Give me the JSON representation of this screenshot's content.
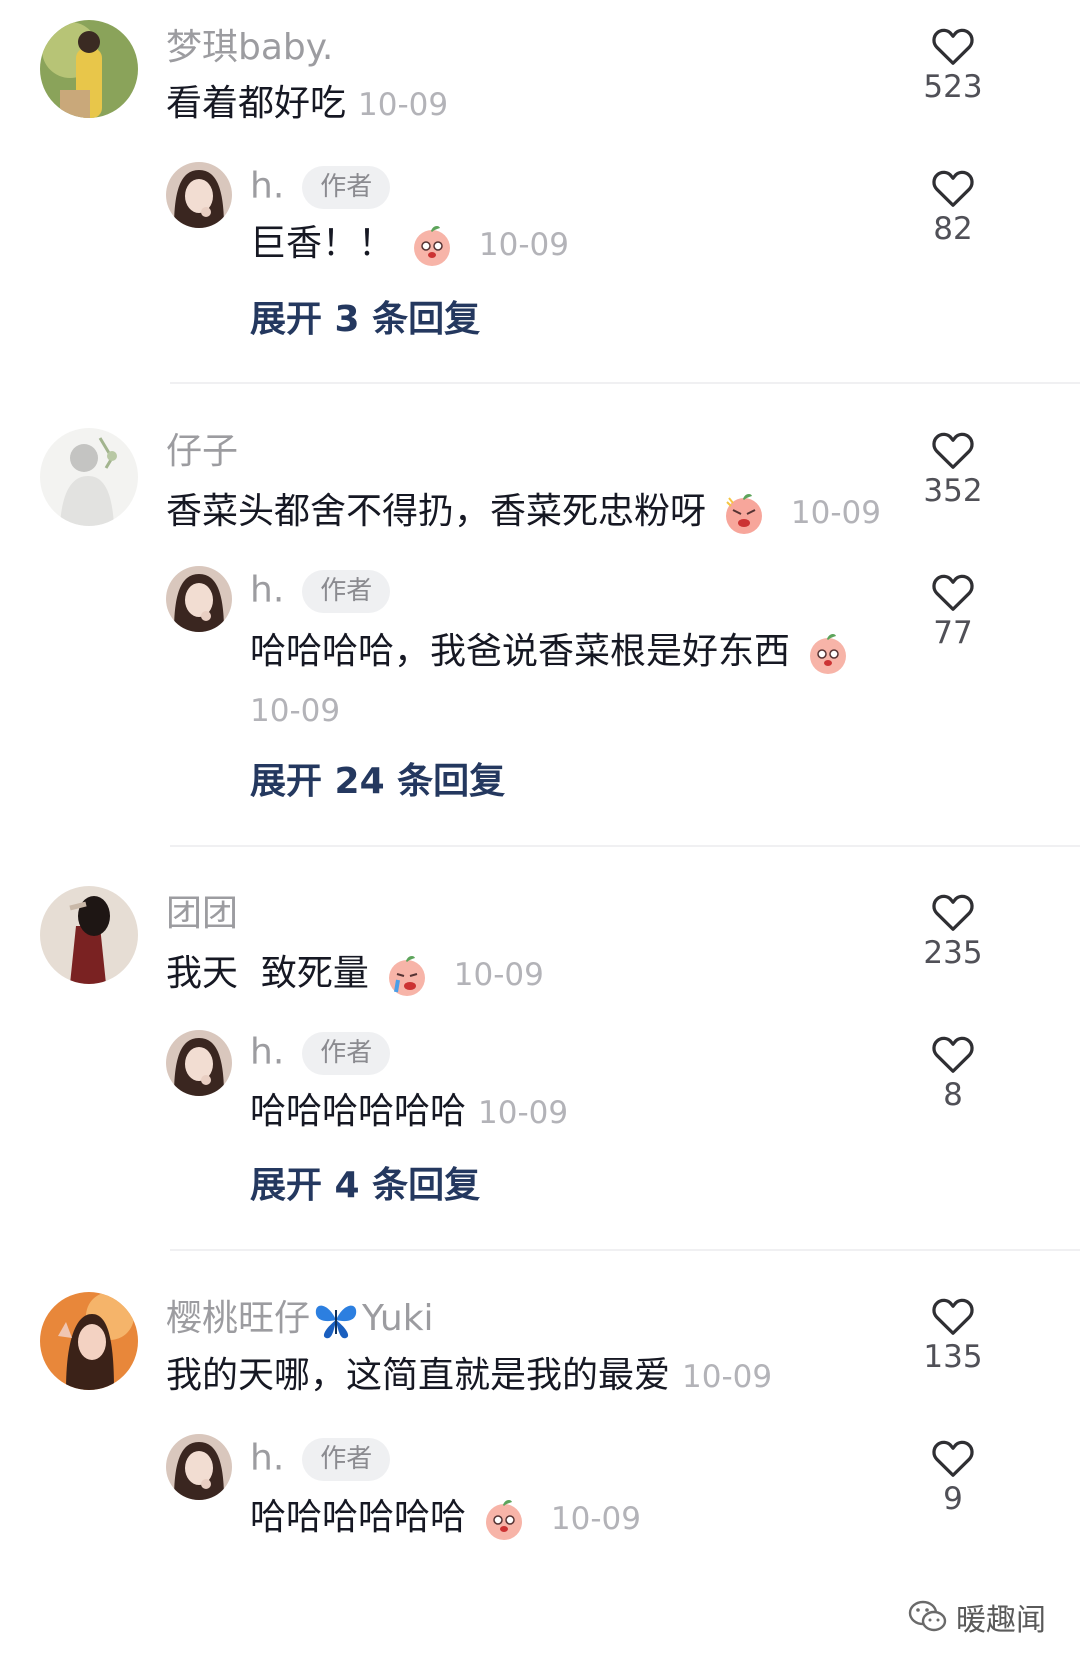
{
  "expand_template_prefix": "展开",
  "threads": [
    {
      "comment": {
        "user": "梦琪baby.",
        "text": "看着都好吃",
        "date": "10-09",
        "likes": "523"
      },
      "reply": {
        "user": "h.",
        "tag": "作者",
        "text": "巨香！！",
        "date": "10-09",
        "likes": "82"
      },
      "expand": "展开 3 条回复"
    },
    {
      "comment": {
        "user": "仔子",
        "text": "香菜头都舍不得扔，香菜死忠粉呀",
        "date": "10-09",
        "likes": "352"
      },
      "reply": {
        "user": "h.",
        "tag": "作者",
        "text": "哈哈哈哈，我爸说香菜根是好东西",
        "date": "10-09",
        "likes": "77"
      },
      "expand": "展开 24 条回复"
    },
    {
      "comment": {
        "user": "团团",
        "text": "我天  致死量",
        "date": "10-09",
        "likes": "235"
      },
      "reply": {
        "user": "h.",
        "tag": "作者",
        "text": "哈哈哈哈哈哈",
        "date": "10-09",
        "likes": "8"
      },
      "expand": "展开 4 条回复"
    },
    {
      "comment": {
        "user_a": "樱桃旺仔",
        "user_b": "Yuki",
        "text": "我的天哪，这简直就是我的最爱",
        "date": "10-09",
        "likes": "135"
      },
      "reply": {
        "user": "h.",
        "tag": "作者",
        "text": "哈哈哈哈哈哈",
        "date": "10-09",
        "likes": "9"
      }
    }
  ],
  "watermark": {
    "text": "暖趣闻",
    "icon": "wechat-icon"
  },
  "colors": {
    "expand": "#24385f",
    "username": "#9c9ca0",
    "date": "#b3b3b8",
    "text": "#161823"
  }
}
